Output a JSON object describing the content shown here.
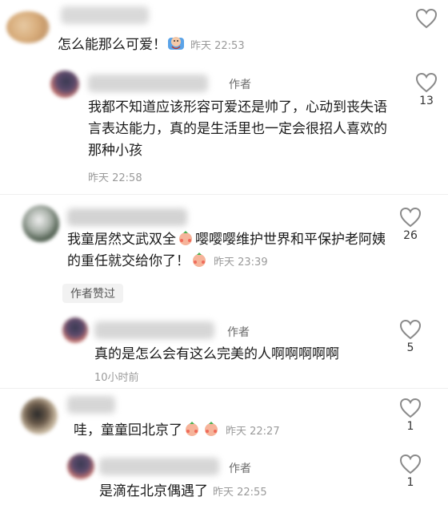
{
  "colors": {
    "heart_stroke": "#9a9a9a",
    "muted": "#9a9a9a",
    "text": "#1a1a1a",
    "tag_bg": "#f2f2f2"
  },
  "comments": [
    {
      "text": "怎么能那么可爱！",
      "emoji": "laughing-emoji",
      "time": "昨天 22:53",
      "likes": ""
    },
    {
      "author_tag": "作者",
      "text": "我都不知道应该形容可爱还是帅了，心动到丧失语言表达能力，真的是生活里也一定会很招人喜欢的那种小孩",
      "time": "昨天 22:58",
      "likes": "13"
    },
    {
      "text_a": "我童居然文武双全",
      "text_b": "嘤嘤嘤维护世界和平保护老阿姨的重任就交给你了！",
      "emoji": "blush-emoji",
      "time": "昨天 23:39",
      "likes": "26",
      "author_liked": "作者赞过"
    },
    {
      "author_tag": "作者",
      "text": "真的是怎么会有这么完美的人啊啊啊啊啊",
      "time": "10小时前",
      "likes": "5"
    },
    {
      "text": "哇，童童回北京了",
      "emoji": "blush-emoji",
      "time": "昨天 22:27",
      "likes": "1"
    },
    {
      "author_tag": "作者",
      "text": "是滴在北京偶遇了",
      "time": "昨天 22:55",
      "likes": "1"
    }
  ]
}
